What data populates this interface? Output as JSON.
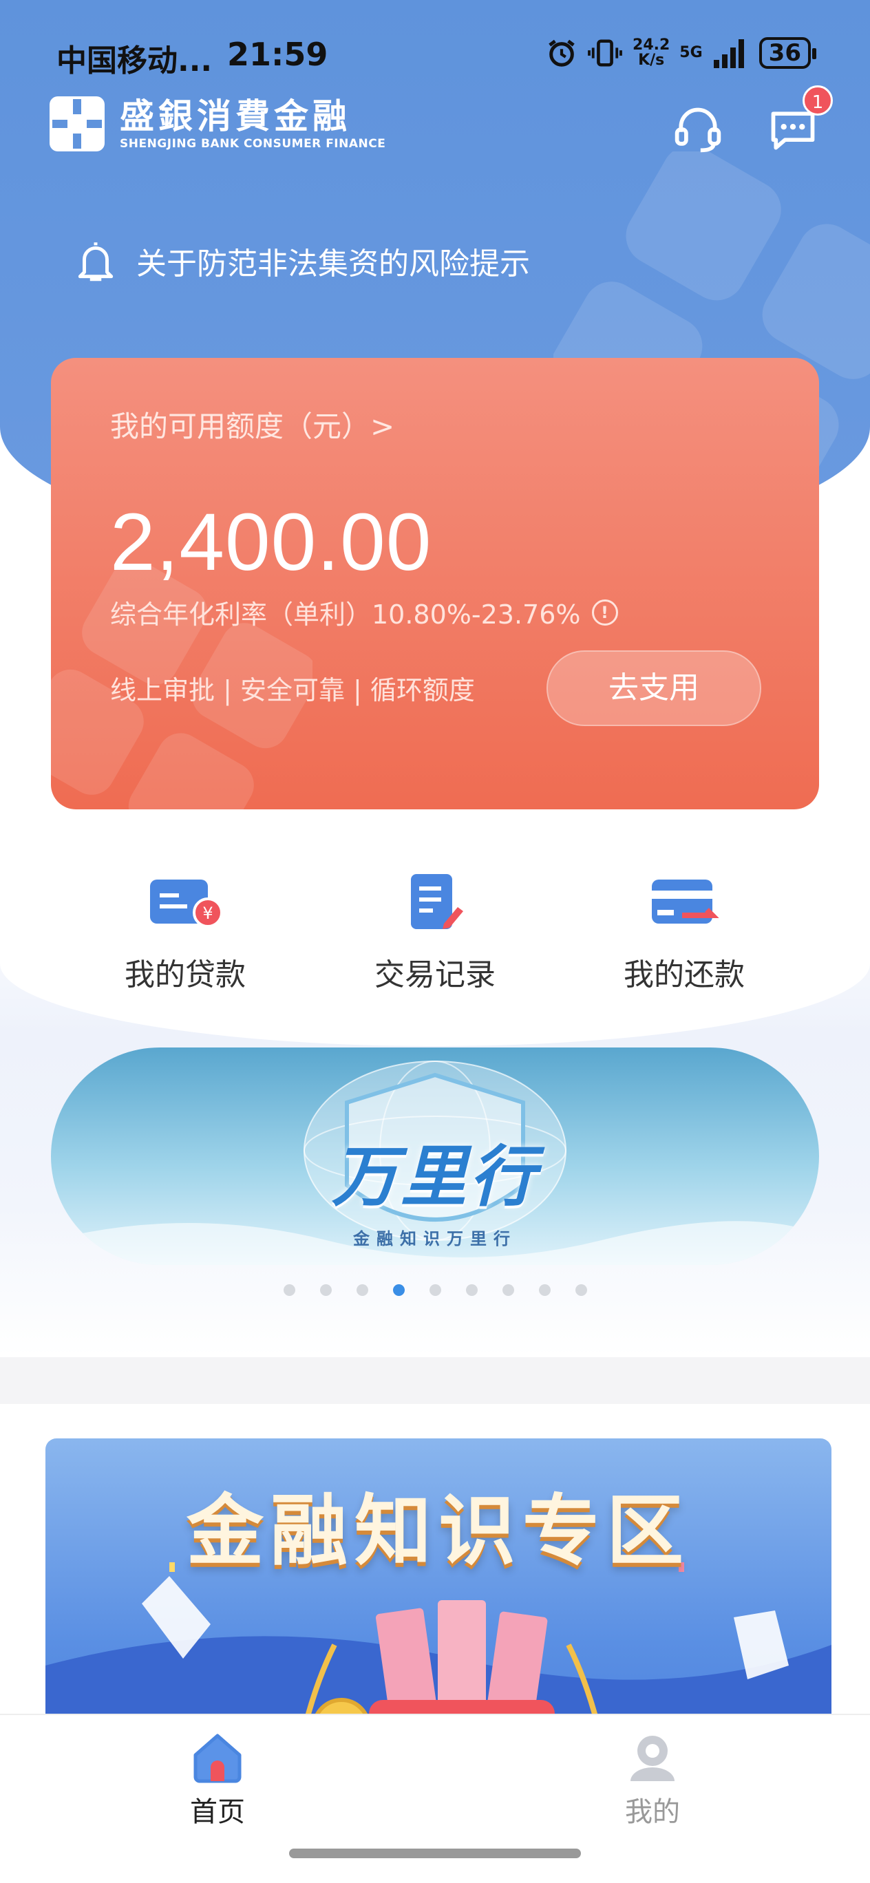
{
  "status_bar": {
    "carrier": "中国移动...",
    "time": "21:59",
    "net_speed_value": "24.2",
    "net_speed_unit": "K/s",
    "network": "5G",
    "battery": "36"
  },
  "header": {
    "brand_cn": "盛銀消費金融",
    "brand_en": "SHENGJING BANK CONSUMER FINANCE",
    "message_badge": "1"
  },
  "notice": {
    "text": "关于防范非法集资的风险提示"
  },
  "credit_card": {
    "label": "我的可用额度（元）>",
    "amount": "2,400.00",
    "rate": "综合年化利率（单利）10.80%-23.76%",
    "info": "!",
    "features": "线上审批 | 安全可靠 | 循环额度",
    "button": "去支用"
  },
  "quick_actions": [
    {
      "label": "我的贷款",
      "icon": "loan-card-icon"
    },
    {
      "label": "交易记录",
      "icon": "transaction-record-icon"
    },
    {
      "label": "我的还款",
      "icon": "repayment-card-icon"
    }
  ],
  "carousel": {
    "title": "万里行",
    "subtitle": "金融知识万里行",
    "dot_count": 9,
    "active_index": 3
  },
  "knowledge_banner": {
    "title": "金融知识专区"
  },
  "tab_bar": {
    "home": "首页",
    "mine": "我的"
  },
  "colors": {
    "header_blue": "#5f93dc",
    "card_top": "#f4907e",
    "card_bottom": "#ef6c52",
    "icon_blue": "#4a86e0",
    "accent_red": "#f0545c",
    "active_dot": "#3a8ee6"
  }
}
